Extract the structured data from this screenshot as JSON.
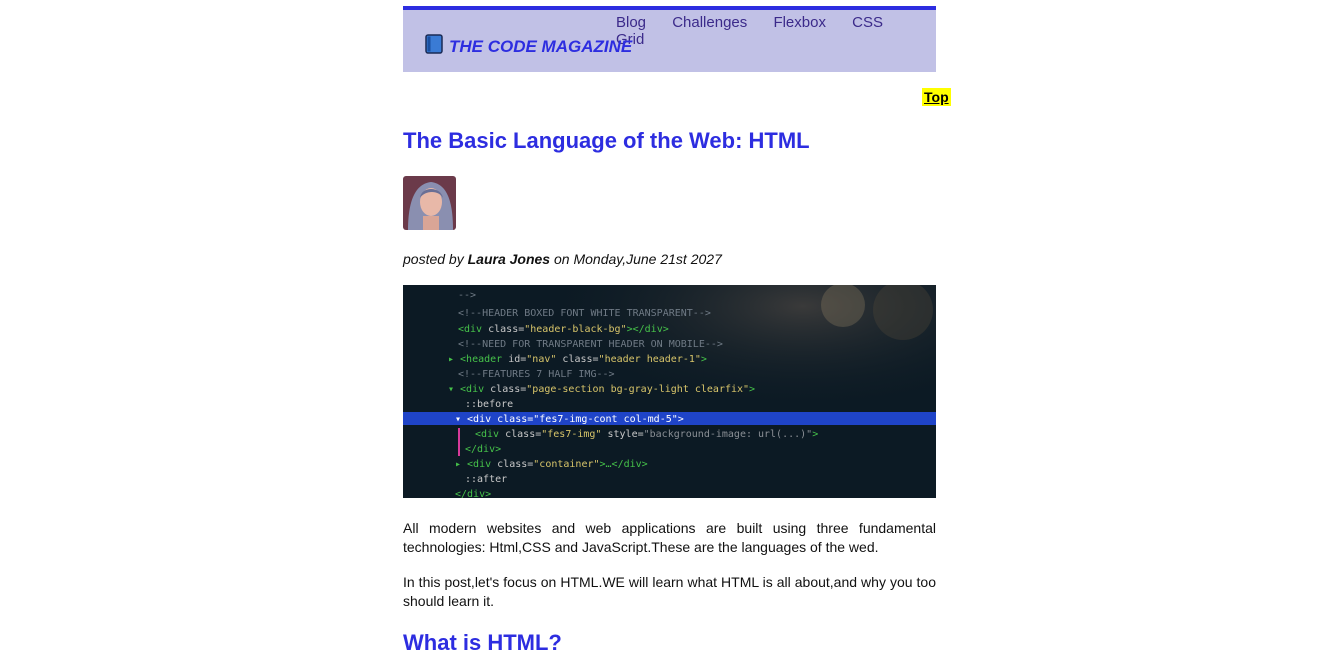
{
  "header": {
    "brand": "THE CODE MAGAZINE",
    "brand_icon": "book-icon",
    "nav": [
      "Blog",
      "Challenges",
      "Flexbox",
      "CSS Grid"
    ]
  },
  "top_button": "Top",
  "article": {
    "title": "The Basic Language of the Web: HTML",
    "posted_by_prefix": "posted by",
    "author": "Laura Jones",
    "date_prefix": "on",
    "date": "Monday,June 21st 2027",
    "paragraph1": "All modern websites and web applications are built using three fundamental technologies: Html,CSS and JavaScript.These are the languages of the wed.",
    "paragraph2": "In this post,let's focus on HTML.WE will learn what HTML is all about,and why you too should learn it.",
    "subheading": "What is HTML?"
  },
  "colors": {
    "accent": "#2d2de0",
    "header_bg": "#c1c1e6",
    "top_button_bg": "#ffff00"
  }
}
